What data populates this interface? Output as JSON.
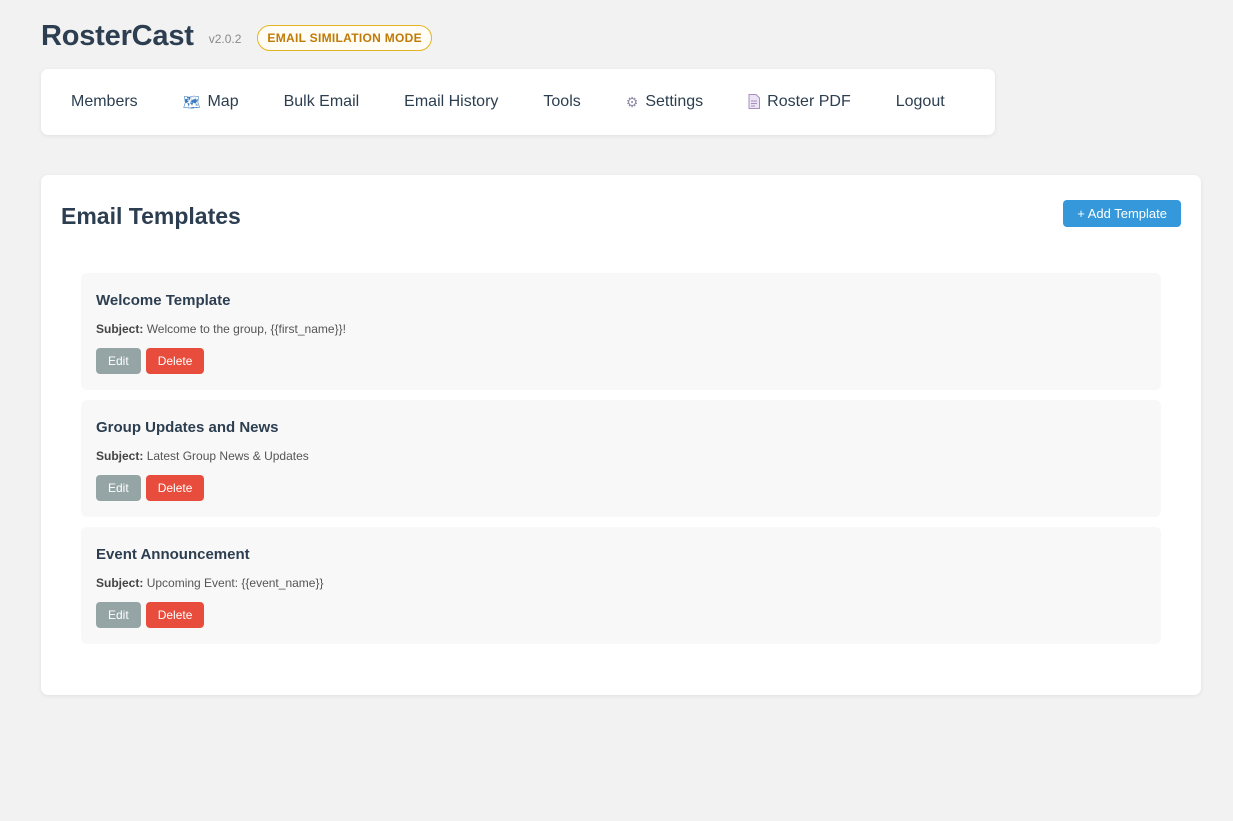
{
  "app": {
    "title": "RosterCast",
    "version": "v2.0.2",
    "mode_badge": "EMAIL SIMILATION MODE"
  },
  "nav": {
    "items": [
      {
        "label": "Members",
        "icon": ""
      },
      {
        "label": "Map",
        "icon": "map-icon"
      },
      {
        "label": "Bulk Email",
        "icon": ""
      },
      {
        "label": "Email History",
        "icon": ""
      },
      {
        "label": "Tools",
        "icon": ""
      },
      {
        "label": "Settings",
        "icon": "gear-icon"
      },
      {
        "label": "Roster PDF",
        "icon": "document-icon"
      },
      {
        "label": "Logout",
        "icon": ""
      }
    ]
  },
  "main": {
    "title": "Email Templates",
    "add_button": "+ Add Template",
    "subject_label": "Subject:",
    "templates": [
      {
        "name": "Welcome Template",
        "subject": "Welcome to the group, {{first_name}}!",
        "edit": "Edit",
        "delete": "Delete"
      },
      {
        "name": "Group Updates and News",
        "subject": "Latest Group News & Updates",
        "edit": "Edit",
        "delete": "Delete"
      },
      {
        "name": "Event Announcement",
        "subject": "Upcoming Event: {{event_name}}",
        "edit": "Edit",
        "delete": "Delete"
      }
    ]
  },
  "colors": {
    "primary": "#3498db",
    "danger": "#e74c3c",
    "secondary": "#95a5a6",
    "text": "#2c3e50",
    "badge": "#e6b422"
  }
}
